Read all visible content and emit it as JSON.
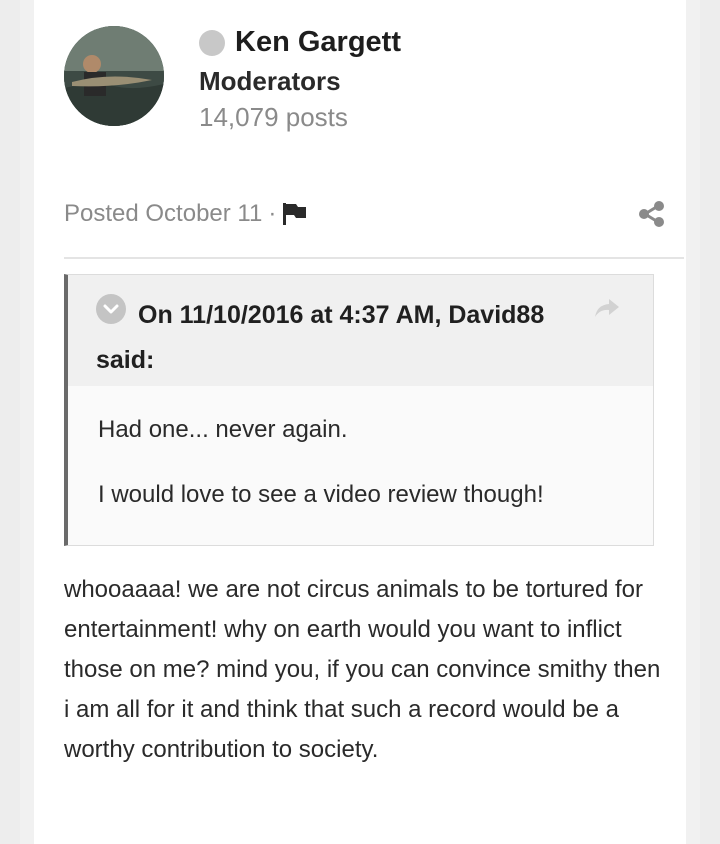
{
  "author": {
    "name": "Ken Gargett",
    "group": "Moderators",
    "post_count": "14,079 posts",
    "online_status_color": "#c8c8c8"
  },
  "post_meta": {
    "posted_prefix": "Posted",
    "date": "October 11",
    "separator": "·",
    "report_icon": "flag-icon",
    "share_icon": "share-icon"
  },
  "quote": {
    "collapse_icon": "chevron-down-icon",
    "citation": "On 11/10/2016 at 4:37 AM, David88 said:",
    "jump_icon": "share-arrow-icon",
    "lines": [
      "Had one... never again.",
      "I would love to see a video review though!"
    ]
  },
  "body": {
    "text": "whooaaaa! we are not circus animals to be tortured for entertainment! why on earth would you want to inflict those on me? mind you, if you can convince smithy then i am all for it and think that such a record would be a worthy contribution to society."
  },
  "colors": {
    "quote_border": "#6a6a6a",
    "meta_text": "#8a8a8a"
  }
}
